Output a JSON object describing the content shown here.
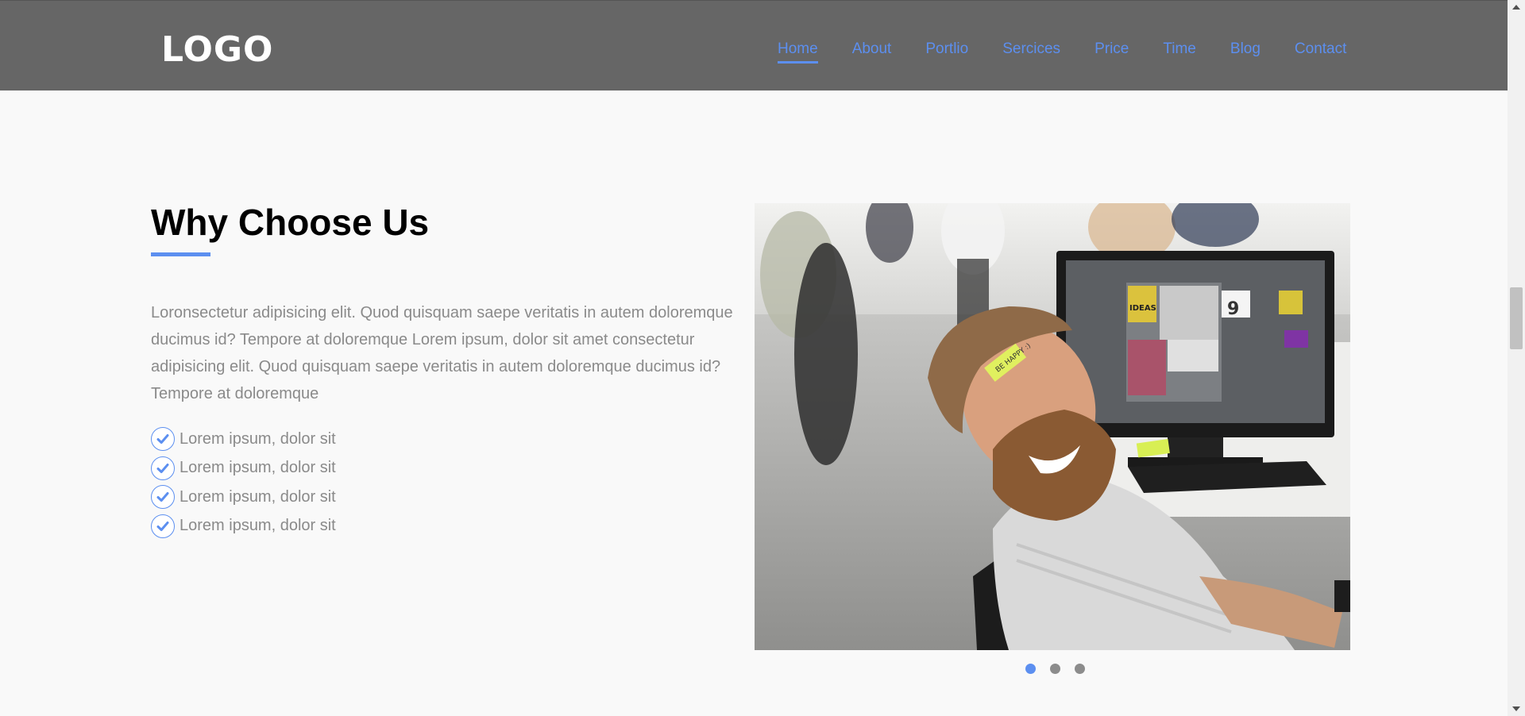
{
  "header": {
    "logo": "LOGO",
    "nav": [
      {
        "label": "Home",
        "active": true
      },
      {
        "label": "About"
      },
      {
        "label": "Portlio"
      },
      {
        "label": "Sercices"
      },
      {
        "label": "Price"
      },
      {
        "label": "Time"
      },
      {
        "label": "Blog"
      },
      {
        "label": "Contact"
      }
    ]
  },
  "section": {
    "title": "Why Choose Us",
    "paragraph": "Loronsectetur adipisicing elit. Quod quisquam saepe veritatis in autem doloremque ducimus id? Tempore at doloremque Lorem ipsum, dolor sit amet consectetur adipisicing elit. Quod quisquam saepe veritatis in autem doloremque ducimus id? Tempore at doloremque",
    "checklist": [
      "Lorem ipsum, dolor sit",
      "Lorem ipsum, dolor sit",
      "Lorem ipsum, dolor sit",
      "Lorem ipsum, dolor sit"
    ],
    "sticky_note": "BE HAPPY :)",
    "screen_label": "IDEAS",
    "carousel": {
      "count": 3,
      "active_index": 0
    }
  },
  "colors": {
    "accent": "#5c8ff0",
    "header_bg": "#666666",
    "page_bg": "#f9f9f9",
    "muted_text": "#8a8a8a"
  },
  "icons": {
    "check": "check-circle-icon",
    "scroll_up": "caret-up-icon",
    "scroll_down": "caret-down-icon"
  }
}
